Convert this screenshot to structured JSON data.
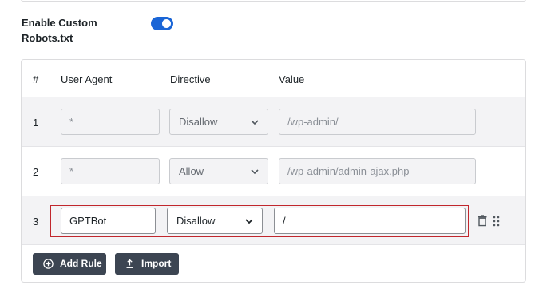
{
  "settings": {
    "enable_label": "Enable Custom Robots.txt",
    "enabled": true
  },
  "table": {
    "headers": {
      "num": "#",
      "user_agent": "User Agent",
      "directive": "Directive",
      "value": "Value"
    },
    "rows": [
      {
        "num": "1",
        "user_agent": "*",
        "directive": "Disallow",
        "value": "/wp-admin/"
      },
      {
        "num": "2",
        "user_agent": "*",
        "directive": "Allow",
        "value": "/wp-admin/admin-ajax.php"
      },
      {
        "num": "3",
        "user_agent": "GPTBot",
        "directive": "Disallow",
        "value": "/"
      }
    ]
  },
  "actions": {
    "add_rule": "Add Rule",
    "import": "Import"
  },
  "colors": {
    "toggle_on": "#1a65d6",
    "button_bg": "#3c4552",
    "highlight_border": "#c1272d"
  }
}
